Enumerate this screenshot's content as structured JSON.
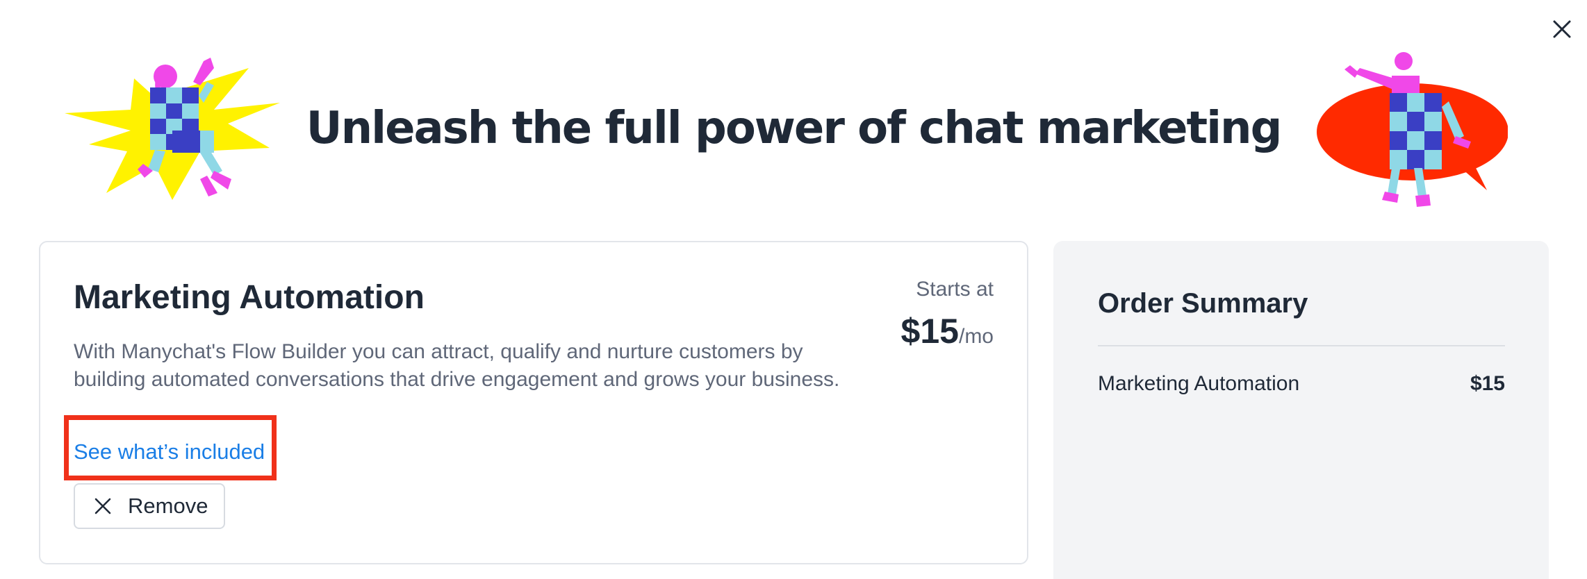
{
  "modal": {
    "headline": "Unleash the full power of chat marketing",
    "close_icon": "close-icon"
  },
  "product": {
    "title": "Marketing Automation",
    "description": "With Manychat's Flow Builder you can attract, qualify and nurture customers by building automated conversations that drive engagement and grows your business.",
    "see_included_label": "See what’s included",
    "remove_label": "Remove",
    "starts_at_label": "Starts at",
    "price": "$15",
    "price_unit": "/mo"
  },
  "order_summary": {
    "title": "Order Summary",
    "items": [
      {
        "name": "Marketing Automation",
        "price": "$15"
      }
    ]
  },
  "colors": {
    "link": "#1a7ee6",
    "highlight": "#f0311a",
    "summary_bg": "#f3f4f6",
    "illustration_yellow": "#fff200",
    "illustration_red": "#ff2a00",
    "illustration_magenta": "#f048e8",
    "illustration_blue": "#3a3fc4",
    "illustration_cyan": "#8fd8e6"
  }
}
